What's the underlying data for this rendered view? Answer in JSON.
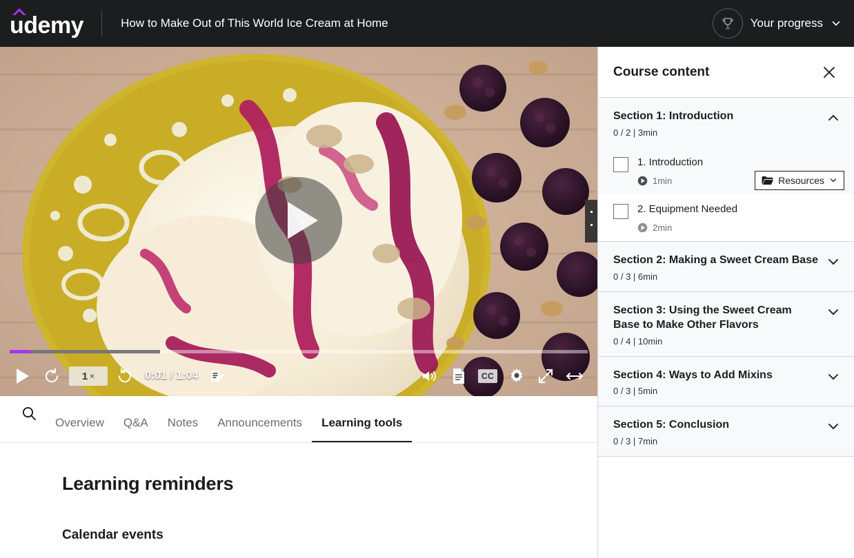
{
  "header": {
    "logo_text": "udemy",
    "logo_accent": "#a435f0",
    "course_title": "How to Make Out of This World Ice Cream at Home",
    "progress_label": "Your progress",
    "trophy_icon": "trophy-icon",
    "chevron_icon": "chevron-down-icon",
    "background": "#1c1d1f"
  },
  "player": {
    "current_time": "0:01",
    "total_time": "1:04",
    "time_display": "0:01 / 1:04",
    "speed": "1",
    "speed_suffix": "×",
    "played_percent": 3.6,
    "buffered_percent": 26,
    "played_color": "#a435f0",
    "controls": {
      "play": "play-icon",
      "rewind": "rewind-10-icon",
      "forward": "forward-10-icon",
      "notes": "add-note-icon",
      "volume": "volume-icon",
      "transcript": "transcript-icon",
      "captions": "CC",
      "settings": "gear-icon",
      "fullscreen": "fullscreen-icon",
      "theater": "expand-width-icon"
    }
  },
  "tabs": {
    "search_icon": "search-icon",
    "items": [
      {
        "label": "Overview",
        "active": false
      },
      {
        "label": "Q&A",
        "active": false
      },
      {
        "label": "Notes",
        "active": false
      },
      {
        "label": "Announcements",
        "active": false
      },
      {
        "label": "Learning tools",
        "active": true
      }
    ]
  },
  "pane": {
    "heading": "Learning reminders",
    "subheading": "Calendar events"
  },
  "sidebar": {
    "title": "Course content",
    "close_icon": "close-icon",
    "resources_label": "Resources",
    "sections": [
      {
        "title": "Section 1: Introduction",
        "meta": "0 / 2 | 3min",
        "expanded": true,
        "chevron": "chevron-up-icon",
        "lectures": [
          {
            "title": "1. Introduction",
            "duration": "1min",
            "current": true,
            "checked": false,
            "has_resources": true
          },
          {
            "title": "2. Equipment Needed",
            "duration": "2min",
            "current": false,
            "checked": false,
            "has_resources": false
          }
        ]
      },
      {
        "title": "Section 2: Making a Sweet Cream Base",
        "meta": "0 / 3 | 6min",
        "expanded": false,
        "chevron": "chevron-down-icon",
        "lectures": []
      },
      {
        "title": "Section 3: Using the Sweet Cream Base to Make Other Flavors",
        "meta": "0 / 4 | 10min",
        "expanded": false,
        "chevron": "chevron-down-icon",
        "lectures": []
      },
      {
        "title": "Section 4: Ways to Add Mixins",
        "meta": "0 / 3 | 5min",
        "expanded": false,
        "chevron": "chevron-down-icon",
        "lectures": []
      },
      {
        "title": "Section 5: Conclusion",
        "meta": "0 / 3 | 7min",
        "expanded": false,
        "chevron": "chevron-down-icon",
        "lectures": []
      }
    ]
  }
}
